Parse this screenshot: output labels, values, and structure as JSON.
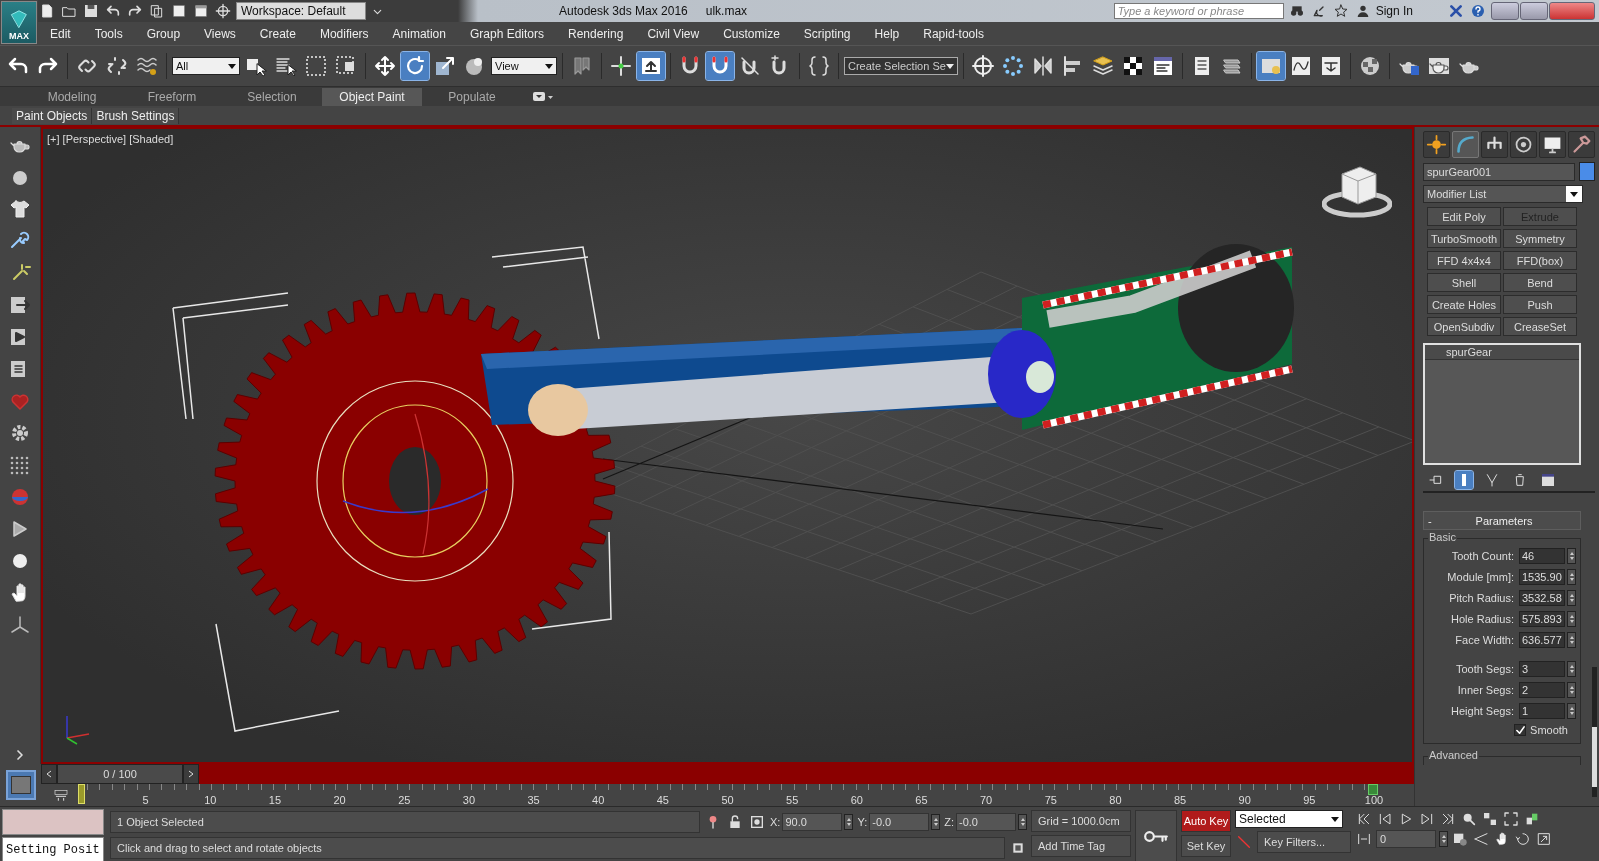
{
  "title_bar": {
    "app_button": "MAX",
    "workspace": "Workspace: Default",
    "title": "Autodesk 3ds Max 2016",
    "file": "ulk.max",
    "search_placeholder": "Type a keyword or phrase",
    "sign_in": "Sign In"
  },
  "menu": [
    "Edit",
    "Tools",
    "Group",
    "Views",
    "Create",
    "Modifiers",
    "Animation",
    "Graph Editors",
    "Rendering",
    "Civil View",
    "Customize",
    "Scripting",
    "Help",
    "Rapid-tools"
  ],
  "main_toolbar": [
    {
      "kind": "button",
      "on": false
    },
    {
      "kind": "button",
      "on": false
    },
    {
      "kind": "button",
      "on": false
    },
    {
      "kind": "button",
      "on": false
    },
    {
      "kind": "button",
      "on": false
    },
    {
      "kind": "dropdown",
      "value": "All"
    },
    {
      "kind": "button",
      "on": false
    },
    {
      "kind": "button",
      "on": false
    },
    {
      "kind": "button",
      "on": false
    },
    {
      "kind": "button",
      "on": false
    },
    {
      "kind": "button",
      "on": false
    },
    {
      "kind": "button",
      "on": true
    },
    {
      "kind": "button",
      "on": false
    },
    {
      "kind": "button",
      "on": false
    },
    {
      "kind": "dropdown",
      "value": "View"
    },
    {
      "kind": "button",
      "on": false
    },
    {
      "kind": "button",
      "on": false
    },
    {
      "kind": "button",
      "on": true
    },
    {
      "kind": "button",
      "on": false
    },
    {
      "kind": "button",
      "on": true
    },
    {
      "kind": "button",
      "on": false
    },
    {
      "kind": "button",
      "on": false
    },
    {
      "kind": "button",
      "on": false
    },
    {
      "kind": "dropdown",
      "value": "Create Selection Se"
    },
    {
      "kind": "button",
      "on": false
    },
    {
      "kind": "button",
      "on": false
    },
    {
      "kind": "button",
      "on": false
    },
    {
      "kind": "button",
      "on": false
    },
    {
      "kind": "button",
      "on": false
    },
    {
      "kind": "button",
      "on": false
    },
    {
      "kind": "button",
      "on": false
    },
    {
      "kind": "button",
      "on": false
    },
    {
      "kind": "button",
      "on": false
    },
    {
      "kind": "button",
      "on": true
    },
    {
      "kind": "button",
      "on": false
    },
    {
      "kind": "button",
      "on": false
    },
    {
      "kind": "button",
      "on": false
    },
    {
      "kind": "button",
      "on": false
    },
    {
      "kind": "button",
      "on": false
    },
    {
      "kind": "button",
      "on": false
    }
  ],
  "ribbon_tabs": [
    {
      "label": "Modeling",
      "selected": false
    },
    {
      "label": "Freeform",
      "selected": false
    },
    {
      "label": "Selection",
      "selected": false
    },
    {
      "label": "Object Paint",
      "selected": true
    },
    {
      "label": "Populate",
      "selected": false
    }
  ],
  "ribbon_panels": [
    "Paint Objects",
    "Brush Settings"
  ],
  "viewport": {
    "label": "[+] [Perspective] [Shaded]",
    "active": true
  },
  "command_panel": {
    "tabs": [
      {
        "selected": false
      },
      {
        "selected": true
      },
      {
        "selected": false
      },
      {
        "selected": false
      },
      {
        "selected": false
      },
      {
        "selected": false
      }
    ],
    "object_name": "spurGear001",
    "modifier_list": "Modifier List",
    "modifier_buttons": [
      {
        "label": "Edit Poly",
        "disabled": false
      },
      {
        "label": "Extrude",
        "disabled": true
      },
      {
        "label": "TurboSmooth",
        "disabled": false
      },
      {
        "label": "Symmetry",
        "disabled": false
      },
      {
        "label": "FFD 4x4x4",
        "disabled": false
      },
      {
        "label": "FFD(box)",
        "disabled": false
      },
      {
        "label": "Shell",
        "disabled": false
      },
      {
        "label": "Bend",
        "disabled": false
      },
      {
        "label": "Create Holes",
        "disabled": false
      },
      {
        "label": "Push",
        "disabled": false
      },
      {
        "label": "OpenSubdiv",
        "disabled": false
      },
      {
        "label": "CreaseSet",
        "disabled": false
      }
    ],
    "stack": [
      "spurGear"
    ],
    "parameters": {
      "toggle": "-",
      "title": "Parameters",
      "basic": {
        "title": "Basic",
        "sections": [
          [
            {
              "label": "Tooth Count:",
              "value": "46"
            },
            {
              "label": "Module [mm]:",
              "value": "1535.90"
            },
            {
              "label": "Pitch Radius:",
              "value": "3532.58"
            },
            {
              "label": "Hole Radius:",
              "value": "575.893"
            },
            {
              "label": "Face Width:",
              "value": "636.577"
            }
          ],
          [
            {
              "label": "Tooth Segs:",
              "value": "3"
            },
            {
              "label": "Inner Segs:",
              "value": "2"
            },
            {
              "label": "Height Segs:",
              "value": "1"
            }
          ]
        ],
        "smooth": {
          "label": "Smooth",
          "checked": true
        }
      },
      "advanced": "Advanced"
    }
  },
  "timeline": {
    "frame": "0 / 100",
    "labels": [
      "5",
      "10",
      "15",
      "20",
      "25",
      "30",
      "35",
      "40",
      "45",
      "50",
      "55",
      "60",
      "65",
      "70",
      "75",
      "80",
      "85",
      "90",
      "95",
      "100"
    ]
  },
  "status_bar": {
    "macro_recorder": "Setting Posit",
    "selection": "1 Object Selected",
    "prompt": "Click and drag to select and rotate objects",
    "coords": [
      {
        "axis": "X:",
        "value": "90.0"
      },
      {
        "axis": "Y:",
        "value": "-0.0"
      },
      {
        "axis": "Z:",
        "value": "-0.0"
      }
    ],
    "grid": "Grid = 1000.0cm",
    "time_tag": "Add Time Tag",
    "auto_key": {
      "label": "Auto Key",
      "on": true
    },
    "key_mode": "Selected",
    "set_key": "Set Key",
    "key_filters": "Key Filters...",
    "frame": "0"
  }
}
